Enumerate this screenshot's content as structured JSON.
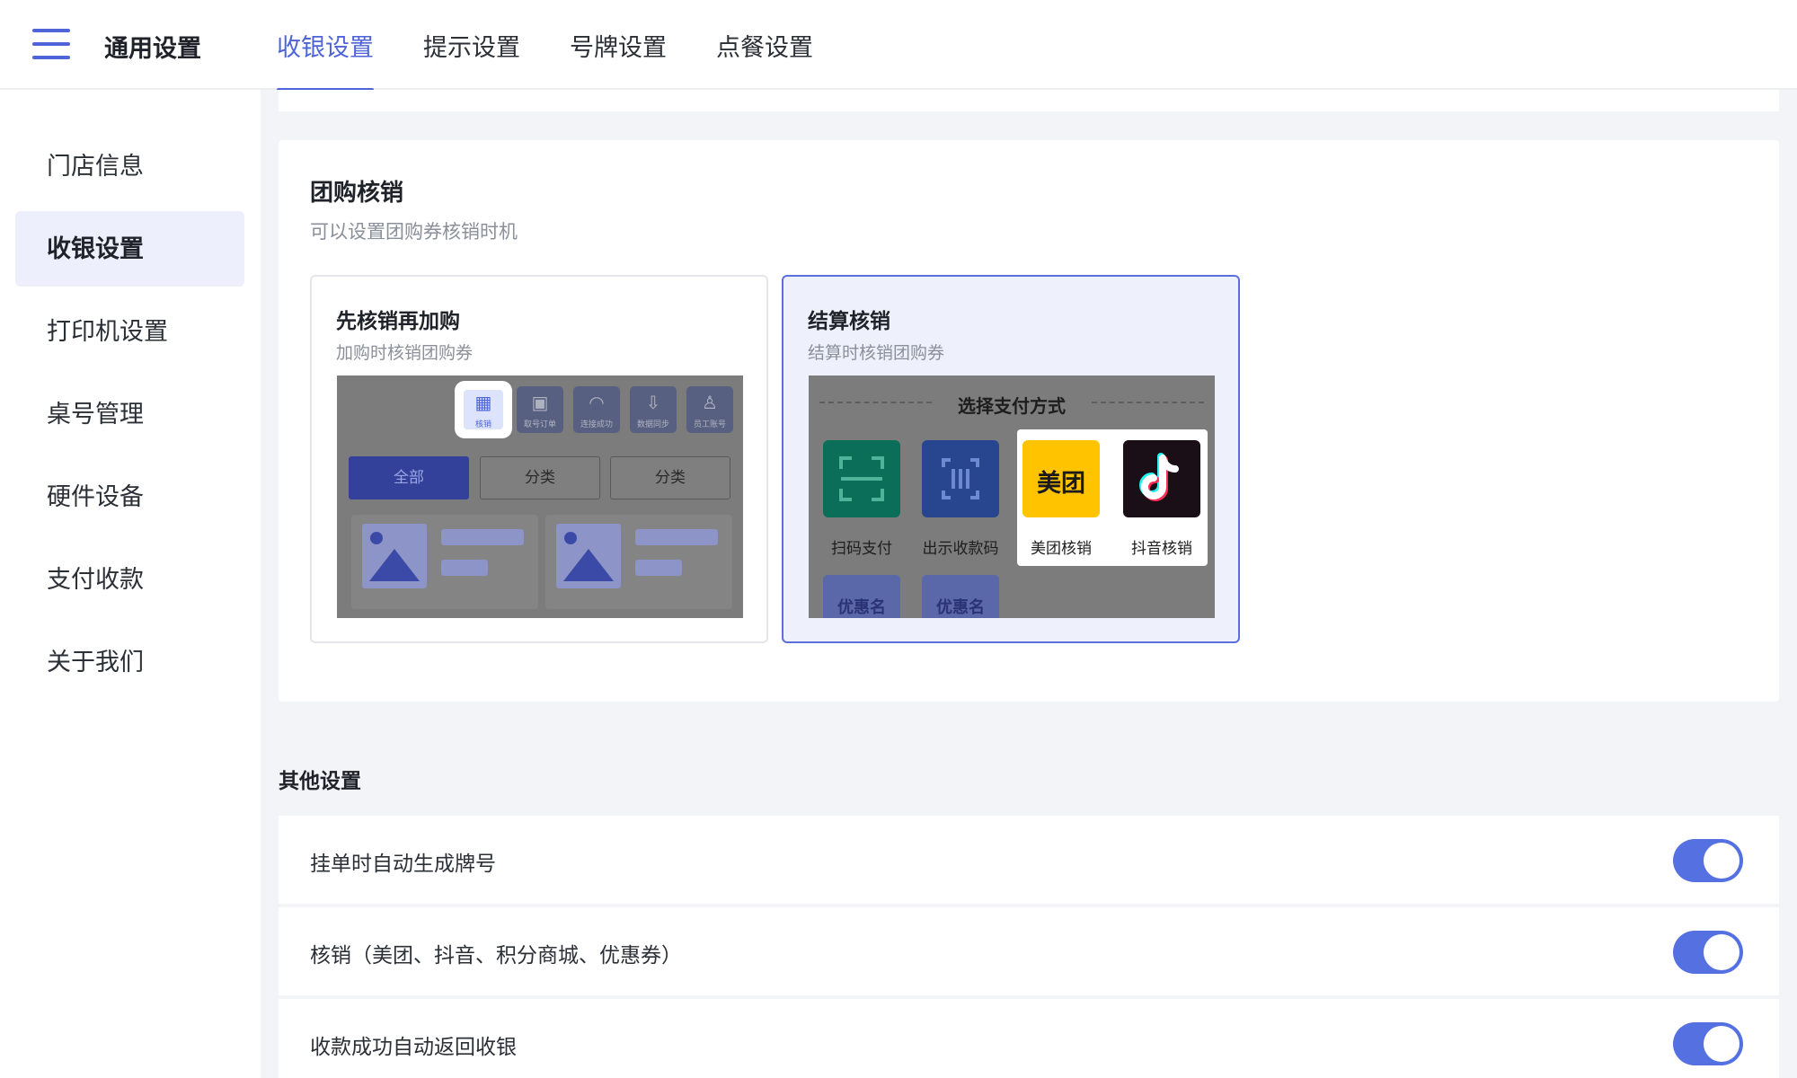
{
  "header": {
    "title": "通用设置",
    "tabs": [
      {
        "label": "收银设置",
        "active": true
      },
      {
        "label": "提示设置",
        "active": false
      },
      {
        "label": "号牌设置",
        "active": false
      },
      {
        "label": "点餐设置",
        "active": false
      }
    ]
  },
  "sidebar": {
    "items": [
      {
        "label": "门店信息",
        "active": false
      },
      {
        "label": "收银设置",
        "active": true
      },
      {
        "label": "打印机设置",
        "active": false
      },
      {
        "label": "桌号管理",
        "active": false
      },
      {
        "label": "硬件设备",
        "active": false
      },
      {
        "label": "支付收款",
        "active": false
      },
      {
        "label": "关于我们",
        "active": false
      }
    ]
  },
  "group_buy": {
    "title": "团购核销",
    "subtitle": "可以设置团购券核销时机",
    "options": [
      {
        "title": "先核销再加购",
        "subtitle": "加购时核销团购券",
        "selected": false,
        "preview": {
          "icons": [
            {
              "icon": "qrcode-icon",
              "label": "核销",
              "highlighted": true
            },
            {
              "icon": "table-number-icon",
              "label": "取号订单",
              "highlighted": false
            },
            {
              "icon": "wifi-icon",
              "label": "连接成功",
              "highlighted": false
            },
            {
              "icon": "download-icon",
              "label": "数据同步",
              "highlighted": false
            },
            {
              "icon": "user-icon",
              "label": "员工账号",
              "highlighted": false
            }
          ],
          "pills": [
            "全部",
            "分类",
            "分类"
          ]
        }
      },
      {
        "title": "结算核销",
        "subtitle": "结算时核销团购券",
        "selected": true,
        "preview": {
          "heading": "选择支付方式",
          "methods": [
            {
              "label": "扫码支付",
              "icon": "scan-icon",
              "color": "#0b6e58"
            },
            {
              "label": "出示收款码",
              "icon": "barcode-icon",
              "color": "#28468f"
            },
            {
              "label": "美团核销",
              "icon": "meituan-logo",
              "logo_text": "美团",
              "color": "#ffc300"
            },
            {
              "label": "抖音核销",
              "icon": "douyin-logo",
              "color": "#1a0f17"
            }
          ],
          "coupons": [
            "优惠名",
            "优惠名"
          ]
        }
      }
    ]
  },
  "other": {
    "title": "其他设置",
    "settings": [
      {
        "label": "挂单时自动生成牌号",
        "enabled": true
      },
      {
        "label": "核销（美团、抖音、积分商城、优惠券）",
        "enabled": true
      },
      {
        "label": "收款成功自动返回收银",
        "enabled": true
      }
    ]
  },
  "colors": {
    "accent": "#4e64d8",
    "toggle_on": "#5570e0",
    "selected_card_bg": "#eef1fc"
  }
}
